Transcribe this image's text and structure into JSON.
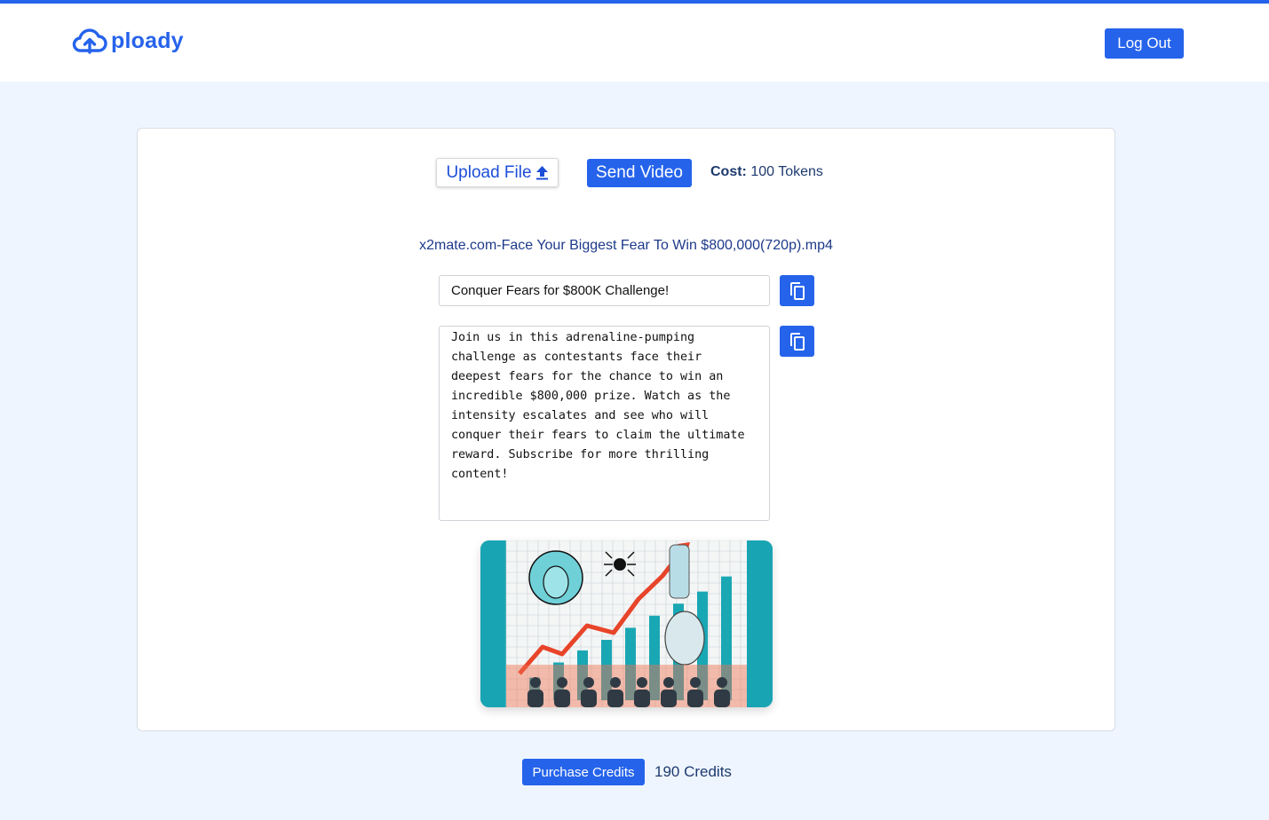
{
  "brand": {
    "name": "ploady",
    "logo_icon": "cloud-upload-icon",
    "accent": "#2563eb"
  },
  "header": {
    "logout_label": "Log Out"
  },
  "toolbar": {
    "upload_label": "Upload File",
    "upload_icon": "upload-arrow-icon",
    "send_label": "Send Video",
    "cost_label": "Cost:",
    "cost_value": "100 Tokens"
  },
  "video": {
    "filename": "x2mate.com-Face Your Biggest Fear To Win $800,000(720p).mp4",
    "title": "Conquer Fears for $800K Challenge!",
    "description": "Join us in this adrenaline-pumping challenge as contestants face their deepest fears for the chance to win an incredible $800,000 prize. Watch as the intensity escalates and see who will conquer their fears to claim the ultimate reward. Subscribe for more thrilling content!",
    "copy_icon": "copy-icon",
    "thumbnail": {
      "title": "",
      "bars": [
        0.15,
        0.25,
        0.33,
        0.4,
        0.48,
        0.56,
        0.64,
        0.72,
        0.82
      ],
      "colors": {
        "bars": "#1aa7b4",
        "arrow": "#e8442a",
        "frame": "#19a4b3"
      }
    }
  },
  "footer": {
    "purchase_label": "Purchase Credits",
    "credits_label": "190 Credits"
  }
}
